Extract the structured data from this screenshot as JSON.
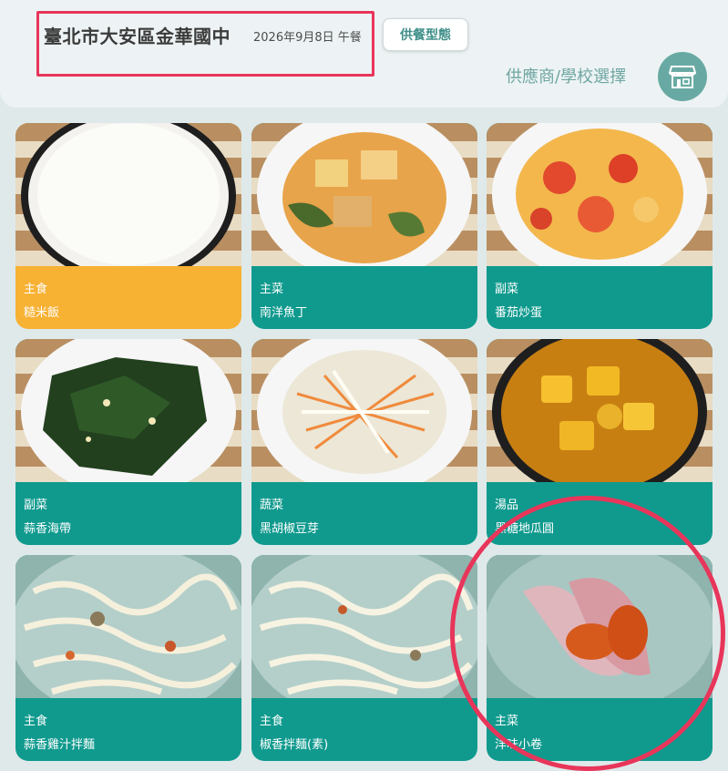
{
  "header": {
    "school": "臺北市大安區金華國中",
    "date": "2026年9月8日 午餐",
    "type_button": "供餐型態",
    "supplier_label": "供應商/學校選擇",
    "store_icon": "store-icon"
  },
  "menu": [
    {
      "category": "主食",
      "dish": "糙米飯",
      "photo": "rice-photo"
    },
    {
      "category": "主菜",
      "dish": "南洋魚丁",
      "photo": "fish-curry-photo"
    },
    {
      "category": "副菜",
      "dish": "番茄炒蛋",
      "photo": "tomato-egg-photo"
    },
    {
      "category": "副菜",
      "dish": "蒜香海帶",
      "photo": "seaweed-photo"
    },
    {
      "category": "蔬菜",
      "dish": "黑胡椒豆芽",
      "photo": "bean-sprout-photo"
    },
    {
      "category": "湯品",
      "dish": "黑糖地瓜圓",
      "photo": "sweet-potato-soup-photo"
    },
    {
      "category": "主食",
      "dish": "蒜香雞汁拌麵",
      "photo": "noodle-photo"
    },
    {
      "category": "主食",
      "dish": "椒香拌麵(素)",
      "photo": "veg-noodle-photo"
    },
    {
      "category": "主菜",
      "dish": "洋味小卷",
      "photo": "squid-photo"
    }
  ],
  "colors": {
    "accent": "#109a8e",
    "highlight_card": "#f7b133",
    "annotation": "#e8355a"
  }
}
